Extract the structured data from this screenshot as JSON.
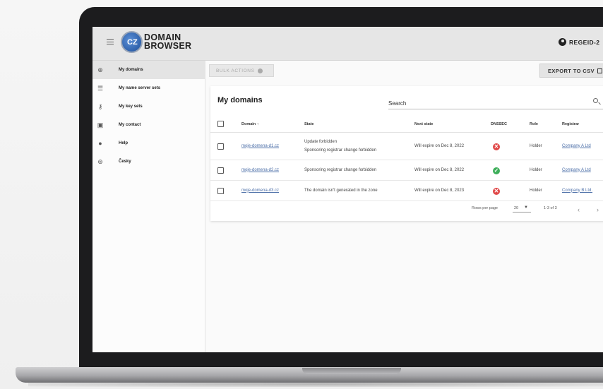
{
  "header": {
    "logo_text_line1": "DOMAIN",
    "logo_text_line2": "BROWSER",
    "logo_badge": "CZ",
    "user_label": "REGEID-2"
  },
  "sidebar": {
    "items": [
      {
        "label": "My domains",
        "icon": "globe-icon",
        "glyph": "⊕",
        "active": true
      },
      {
        "label": "My name server sets",
        "icon": "server-icon",
        "glyph": "☰",
        "active": false
      },
      {
        "label": "My key sets",
        "icon": "key-icon",
        "glyph": "⚷",
        "active": false
      },
      {
        "label": "My contact",
        "icon": "contact-card-icon",
        "glyph": "▣",
        "active": false
      },
      {
        "label": "Help",
        "icon": "help-icon",
        "glyph": "●",
        "active": false
      },
      {
        "label": "Česky",
        "icon": "language-globe-icon",
        "glyph": "⊛",
        "active": false
      }
    ]
  },
  "toolbar": {
    "bulk_actions_label": "BULK ACTIONS",
    "export_label": "EXPORT TO CSV"
  },
  "card": {
    "title": "My domains",
    "search_label": "Search"
  },
  "table": {
    "columns": [
      "Domain",
      "State",
      "Next state",
      "DNSSEC",
      "Role",
      "Registrar"
    ],
    "sort_indicator": "↑",
    "rows": [
      {
        "domain": "moje-domena-d1.cz",
        "state": [
          "Update forbidden",
          "Sponsoring registrar change forbidden"
        ],
        "next_state": "Will expire on Dec 8, 2022",
        "dnssec": "bad",
        "dnssec_glyph": "✕",
        "role": "Holder",
        "registrar": "Company A Ltd"
      },
      {
        "domain": "moje-domena-d2.cz",
        "state": [
          "Sponsoring registrar change forbidden"
        ],
        "next_state": "Will expire on Dec 8, 2022",
        "dnssec": "ok",
        "dnssec_glyph": "✓",
        "role": "Holder",
        "registrar": "Company A Ltd"
      },
      {
        "domain": "moje-domena-d3.cz",
        "state": [
          "The domain isn't generated in the zone"
        ],
        "next_state": "Will expire on Dec 8, 2023",
        "dnssec": "bad",
        "dnssec_glyph": "✕",
        "role": "Holder",
        "registrar": "Company B Ltd."
      }
    ]
  },
  "pagination": {
    "rows_per_page_label": "Rows per page",
    "rows_per_page_value": "20",
    "range_label": "1-3 of 3",
    "prev": "‹",
    "next": "›"
  },
  "colors": {
    "dnssec_bad": "#e04848",
    "dnssec_ok": "#3eae5a",
    "link": "#4c6fa8"
  }
}
